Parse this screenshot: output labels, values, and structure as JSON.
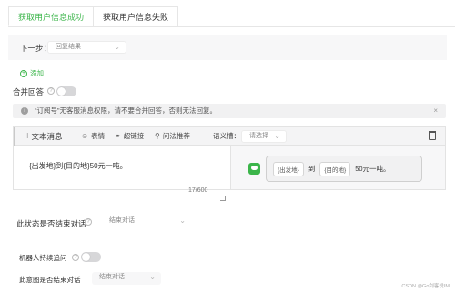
{
  "tabs": [
    {
      "label": "获取用户信息成功",
      "active": true
    },
    {
      "label": "获取用户信息失败",
      "active": false
    }
  ],
  "next_step": {
    "label": "下一步：",
    "value": "回复结果"
  },
  "add_link": {
    "label": "添加"
  },
  "merge_reply": {
    "label": "合并回答",
    "enabled": false
  },
  "notice": {
    "text": "“订阅号”无客服消息权限，请不要合并回答，否则无法回复。",
    "close": "×"
  },
  "editor": {
    "title": "文本消息",
    "toolbar": {
      "emoji": "表情",
      "hyperlink": "超链接",
      "recommend": "问法推荐",
      "slot_label": "语义槽：",
      "slot_placeholder": "请选择"
    },
    "content": "{出发地}到{目的地}50元一吨。",
    "char_count": "17/600",
    "preview": {
      "chip1": "{出发地}",
      "mid": "到",
      "chip2": "{目的地}",
      "tail": "50元一吨。"
    }
  },
  "end_dialog": {
    "label": "此状态是否结束对话",
    "value": "结束对话"
  },
  "robot_followup": {
    "label": "机器人持续追问",
    "enabled": false
  },
  "intent_end": {
    "label": "此意图是否结束对话",
    "value": "结束对话"
  },
  "watermark": "CSDN @Go剑客说IM",
  "colors": {
    "accent": "#3bb54a",
    "panel": "#f7f7f8"
  }
}
